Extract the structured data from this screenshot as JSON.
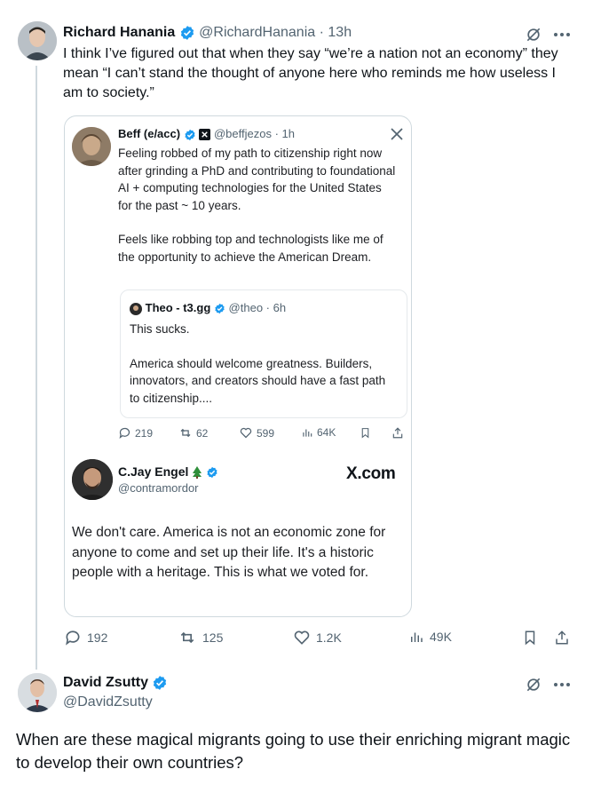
{
  "tweet1": {
    "author_name": "Richard Hanania",
    "handle": "@RichardHanania",
    "separator": "·",
    "time": "13h",
    "text": "I think I’ve figured out that when they say “we’re a nation not an economy” they mean “I can’t stand the thought of anyone here who reminds me how useless I am to society.”",
    "actions": {
      "replies": "192",
      "reposts": "125",
      "likes": "1.2K",
      "views": "49K"
    }
  },
  "embedded_image": {
    "beff": {
      "name": "Beff (e/acc)",
      "handle": "@beffjezos",
      "separator": "·",
      "time": "1h",
      "para1": "Feeling robbed of my path to citizenship right now after grinding a PhD and contributing to foundational AI + computing technologies for the United States for the past ~ 10 years.",
      "para2": "Feels like robbing top and technologists like me of the opportunity to achieve the American Dream."
    },
    "theo": {
      "name": "Theo - t3.gg",
      "handle": "@theo",
      "separator": "·",
      "time": "6h",
      "para1": "This sucks.",
      "para2": "America should welcome greatness. Builders, innovators, and creators should have a fast path to citizenship...."
    },
    "beff_actions": {
      "replies": "219",
      "reposts": "62",
      "likes": "599",
      "views": "64K"
    },
    "jay": {
      "name": "C.Jay Engel",
      "handle": "@contramordor",
      "text": "We don't care. America is not an economic zone for anyone to come and set up their life. It's a historic people with a heritage. This is what we voted for."
    },
    "watermark": "X.com"
  },
  "tweet2": {
    "author_name": "David Zsutty",
    "handle": "@DavidZsutty",
    "text": "When are these magical migrants going to use their enriching migrant magic to develop their own countries?"
  },
  "colors": {
    "verified": "#1d9bf0",
    "muted": "#536471",
    "border": "#cfd9de"
  }
}
